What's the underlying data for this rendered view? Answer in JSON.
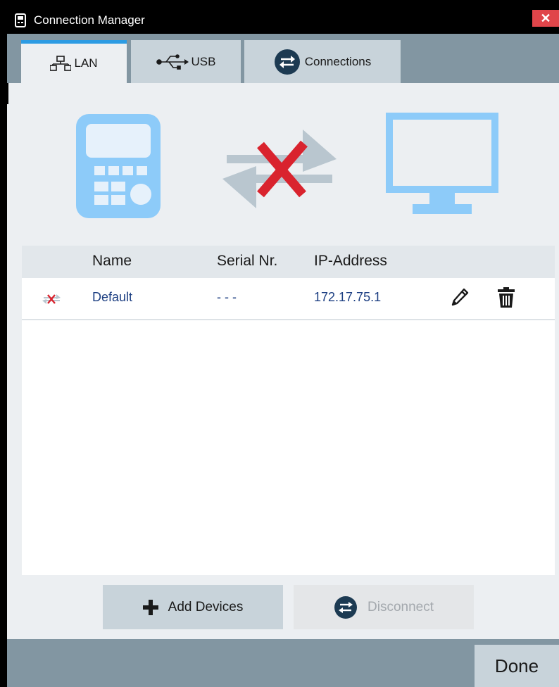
{
  "window": {
    "title": "Connection Manager",
    "close_label": "✕",
    "app_icon": "handheld-device-icon"
  },
  "tabs": [
    {
      "label": "LAN",
      "icon": "network-icon",
      "active": true
    },
    {
      "label": "USB",
      "icon": "usb-icon",
      "active": false
    },
    {
      "label": "Connections",
      "icon": "connections-icon",
      "active": false
    }
  ],
  "illustration": {
    "device_icon": "handheld-instrument-icon",
    "link_icon": "disconnected-arrows-icon",
    "monitor_icon": "monitor-icon"
  },
  "table": {
    "headers": {
      "name": "Name",
      "serial": "Serial Nr.",
      "ip": "IP-Address"
    },
    "rows": [
      {
        "status_icon": "disconnected-icon",
        "name": "Default",
        "serial": "- - -",
        "ip": "172.17.75.1"
      }
    ]
  },
  "buttons": {
    "add_devices": "Add Devices",
    "disconnect": "Disconnect"
  },
  "footer": {
    "done": "Done"
  },
  "colors": {
    "accent": "#2c9be3",
    "tab_strip": "#8296a2",
    "illustration_blue": "#8dcbf9",
    "disconnect_red": "#d9232e",
    "link_text": "#1d3f82"
  }
}
